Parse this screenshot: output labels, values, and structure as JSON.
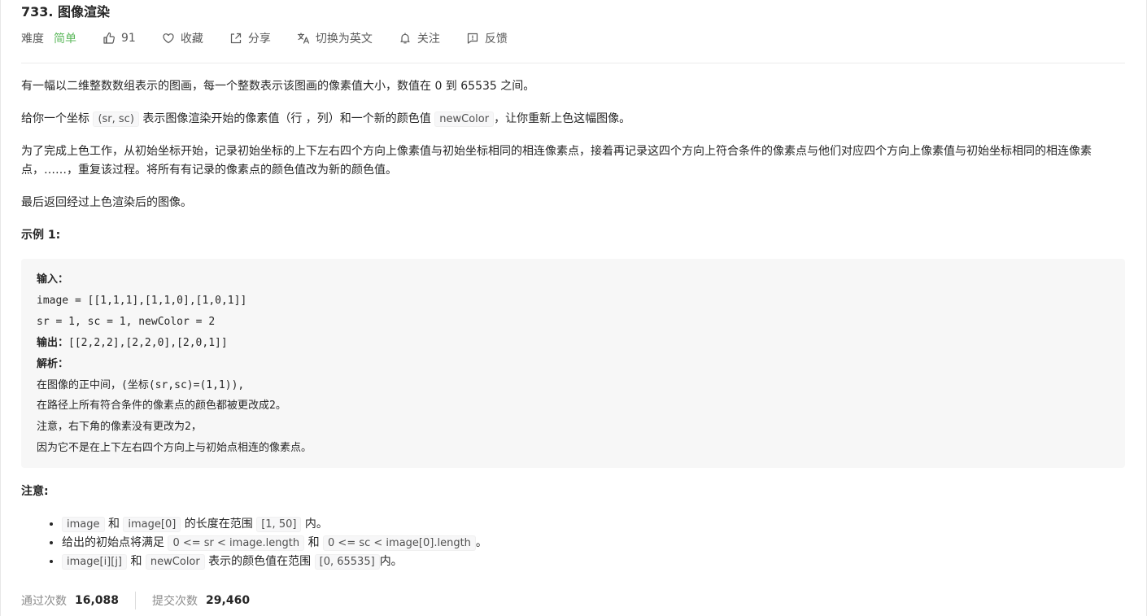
{
  "title": "733. 图像渲染",
  "meta": {
    "difficulty_label": "难度",
    "difficulty_value": "简单",
    "likes": "91",
    "favorite": "收藏",
    "share": "分享",
    "switch_lang": "切换为英文",
    "follow": "关注",
    "feedback": "反馈"
  },
  "colors": {
    "difficulty_easy": "#5cb85c"
  },
  "description": {
    "p1": "有一幅以二维整数数组表示的图画，每一个整数表示该图画的像素值大小，数值在 0 到 65535 之间。",
    "p2_a": "给你一个坐标 ",
    "p2_code1": "(sr, sc)",
    "p2_b": " 表示图像渲染开始的像素值（行 ，列）和一个新的颜色值 ",
    "p2_code2": "newColor",
    "p2_c": "，让你重新上色这幅图像。",
    "p3": "为了完成上色工作，从初始坐标开始，记录初始坐标的上下左右四个方向上像素值与初始坐标相同的相连像素点，接着再记录这四个方向上符合条件的像素点与他们对应四个方向上像素值与初始坐标相同的相连像素点，……，重复该过程。将所有有记录的像素点的颜色值改为新的颜色值。",
    "p4": "最后返回经过上色渲染后的图像。"
  },
  "example": {
    "title": "示例 1:",
    "input_label": "输入：",
    "input_line1": "image = [[1,1,1],[1,1,0],[1,0,1]]",
    "input_line2": "sr = 1, sc = 1, newColor = 2",
    "output_label": "输出：",
    "output_value": "[[2,2,2],[2,2,0],[2,0,1]]",
    "explain_label": "解析：",
    "explain_line1": "在图像的正中间，(坐标(sr,sc)=(1,1)),",
    "explain_line2": "在路径上所有符合条件的像素点的颜色都被更改成2。",
    "explain_line3": "注意，右下角的像素没有更改为2，",
    "explain_line4": "因为它不是在上下左右四个方向上与初始点相连的像素点。"
  },
  "notes": {
    "title": "注意:",
    "n1_code1": "image",
    "n1_a": " 和 ",
    "n1_code2": "image[0]",
    "n1_b": " 的长度在范围 ",
    "n1_code3": "[1, 50]",
    "n1_c": " 内。",
    "n2_a": "给出的初始点将满足 ",
    "n2_code1": "0 <= sr < image.length",
    "n2_b": " 和 ",
    "n2_code2": "0 <= sc < image[0].length",
    "n2_c": "。",
    "n3_code1": "image[i][j]",
    "n3_a": " 和 ",
    "n3_code2": "newColor",
    "n3_b": " 表示的颜色值在范围 ",
    "n3_code3": "[0, 65535]",
    "n3_c": "内。"
  },
  "stats": {
    "accepted_label": "通过次数",
    "accepted_value": "16,088",
    "submitted_label": "提交次数",
    "submitted_value": "29,460"
  }
}
